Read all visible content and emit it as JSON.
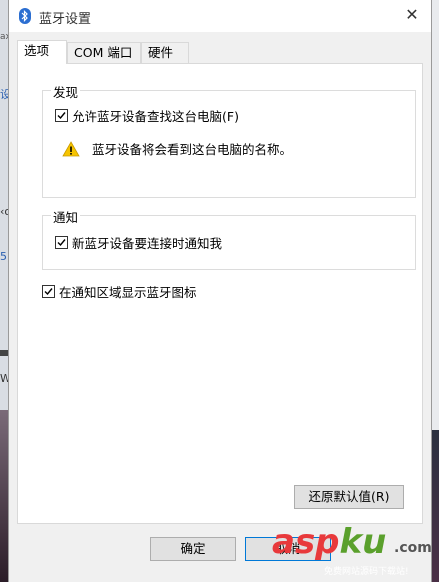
{
  "window": {
    "title": "蓝牙设置",
    "close_glyph": "✕"
  },
  "tabs": [
    {
      "label": "选项",
      "active": true
    },
    {
      "label": "COM 端口",
      "active": false
    },
    {
      "label": "硬件",
      "active": false
    }
  ],
  "discovery": {
    "label": "发现",
    "allow_checkbox": {
      "label": "允许蓝牙设备查找这台电脑(F)",
      "checked": true
    },
    "warning_text": "蓝牙设备将会看到这台电脑的名称。"
  },
  "notification": {
    "label": "通知",
    "notify_checkbox": {
      "label": "新蓝牙设备要连接时通知我",
      "checked": true
    }
  },
  "tray_checkbox": {
    "label": "在通知区域显示蓝牙图标",
    "checked": true
  },
  "buttons": {
    "restore": "还原默认值(R)",
    "ok": "确定",
    "cancel": "取消"
  },
  "watermark": {
    "brand_a": "asp",
    "brand_b": "ku",
    "domain": ".com",
    "tagline": "免费网站源码下载站!"
  },
  "background_fragments": [
    "ax",
    "设",
    "‹o",
    "5)",
    "Wi"
  ],
  "colors": {
    "bluetooth": "#2b6ed1",
    "warning": "#f6c400",
    "accent_border": "#0078d7"
  }
}
